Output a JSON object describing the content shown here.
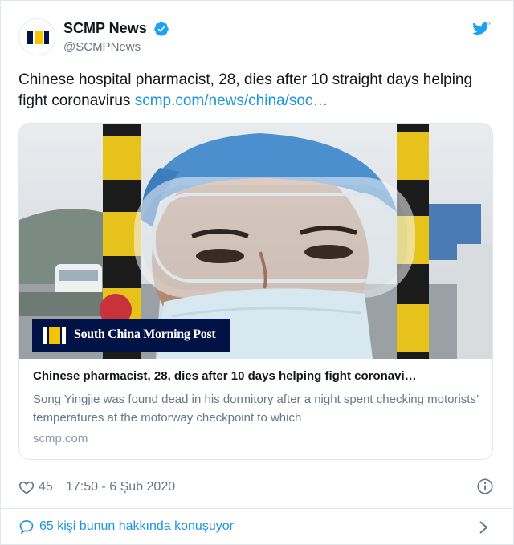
{
  "colors": {
    "accent": "#1b95e0",
    "brand_navy": "#001246",
    "brand_yellow": "#f5c400"
  },
  "author": {
    "display_name": "SCMP News",
    "handle": "@SCMPNews",
    "avatar_icon": "scmp-logo-icon",
    "verified_icon": "verified-badge-icon"
  },
  "platform_icon": "twitter-bird-icon",
  "tweet": {
    "text": "Chinese hospital pharmacist, 28, dies after 10 straight days helping fight coronavirus ",
    "link_text": "scmp.com/news/china/soc…"
  },
  "card": {
    "image_icon": "pharmacist-photo",
    "badge_text": "South China Morning Post",
    "title": "Chinese pharmacist, 28, dies after 10 days helping fight coronavi…",
    "description": "Song Yingjie was found dead in his dormitory after a night spent checking motorists’ temperatures at the motorway checkpoint to which",
    "domain": "scmp.com"
  },
  "meta": {
    "like_icon": "heart-icon",
    "likes": "45",
    "timestamp": "17:50 - 6 Şub 2020",
    "info_icon": "info-icon"
  },
  "conversation": {
    "icon": "reply-bubble-icon",
    "label": "65 kişi bunun hakkında konuşuyor",
    "chevron_icon": "chevron-right-icon"
  }
}
